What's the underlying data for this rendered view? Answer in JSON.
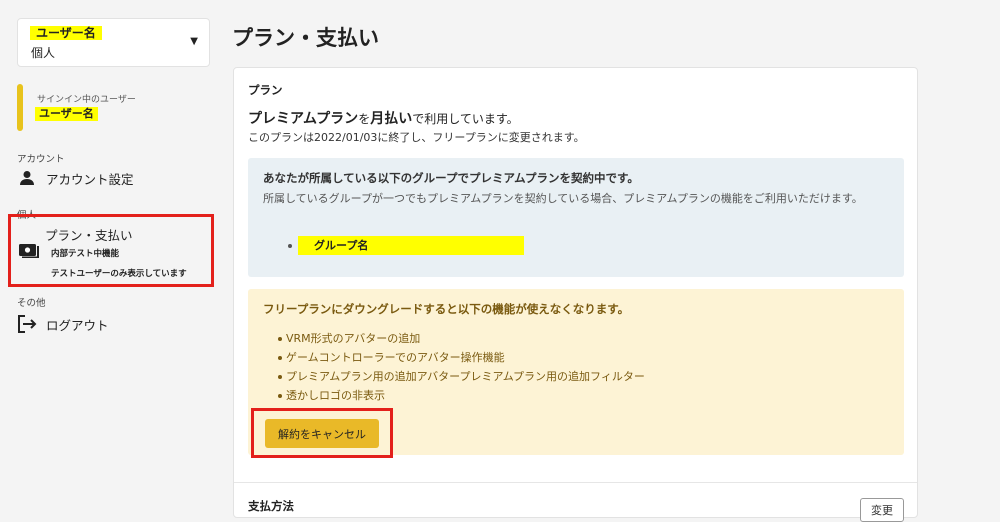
{
  "sidebar": {
    "account_selector": {
      "name": "ユーザー名",
      "type": "個人"
    },
    "signin": {
      "caption": "サインイン中のユーザー",
      "user": "ユーザー名"
    },
    "sections": {
      "account": "アカウント",
      "personal": "個人",
      "other": "その他"
    },
    "items": {
      "account_settings": "アカウント設定",
      "plan_payment": "プラン・支払い",
      "plan_sub1": "内部テスト中機能",
      "plan_sub2": "テストユーザーのみ表示しています",
      "logout": "ログアウト"
    }
  },
  "main": {
    "title": "プラン・支払い",
    "plan": {
      "heading": "プラン",
      "line_bold1": "プレミアムプラン",
      "line_text1": "を",
      "line_bold2": "月払い",
      "line_text2": "で利用しています。",
      "end_notice": "このプランは2022/01/03に終了し、フリープランに変更されます。"
    },
    "group_box": {
      "heading": "あなたが所属している以下のグループでプレミアムプランを契約中です。",
      "text": "所属しているグループが一つでもプレミアムプランを契約している場合、プレミアムプランの機能をご利用いただけます。",
      "group_name": "グループ名"
    },
    "downgrade_box": {
      "heading": "フリープランにダウングレードすると以下の機能が使えなくなります。",
      "features": [
        "VRM形式のアバターの追加",
        "ゲームコントローラーでのアバター操作機能",
        "プレミアムプラン用の追加アバタープレミアムプラン用の追加フィルター",
        "透かしロゴの非表示"
      ],
      "cancel_label": "解約をキャンセル"
    },
    "payment": {
      "heading": "支払方法",
      "change_label": "変更"
    }
  }
}
